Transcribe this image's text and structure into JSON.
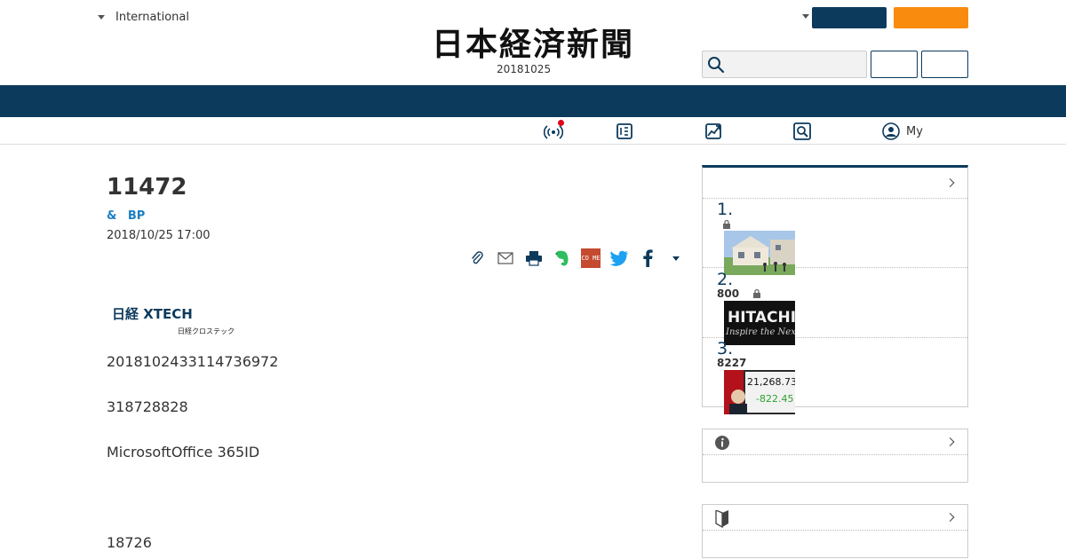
{
  "header": {
    "region_label": "International",
    "edition": "20181025",
    "logo_text": "日本経済新聞"
  },
  "subnav": {
    "my_label": "My"
  },
  "article": {
    "title": "11472",
    "byline": "& BP",
    "date": "2018/10/25 17:00",
    "source_logo_text": "日経 XTECH",
    "source_logo_sub": "日経クロステック",
    "paragraphs": [
      "2018102433114736972",
      "318728828",
      "MicrosoftOffice 365ID",
      "18726"
    ]
  },
  "share": {
    "come_label": "CO ME"
  },
  "ranking": {
    "items": [
      {
        "num": "1.",
        "sub": ""
      },
      {
        "num": "2.",
        "sub": "800"
      },
      {
        "num": "3.",
        "sub": "8227"
      }
    ],
    "thumb2_text": "HITACHI",
    "thumb2_tagline": "Inspire the Next",
    "thumb3_value1": "21,268.73",
    "thumb3_value2": "-822.45"
  },
  "colors": {
    "navy": "#0c3a5c",
    "orange": "#f98b0e",
    "link": "#1a7fc1",
    "notification_red": "#e1001a"
  },
  "icons": [
    "caret-down-icon",
    "search-icon",
    "live-broadcast-icon",
    "newspaper-icon",
    "market-chart-icon",
    "search-article-icon",
    "user-circle-icon",
    "clip-icon",
    "mail-icon",
    "print-icon",
    "evernote-icon",
    "come-icon",
    "twitter-icon",
    "facebook-icon",
    "info-icon",
    "beginner-mark-icon",
    "chevron-right-icon"
  ]
}
